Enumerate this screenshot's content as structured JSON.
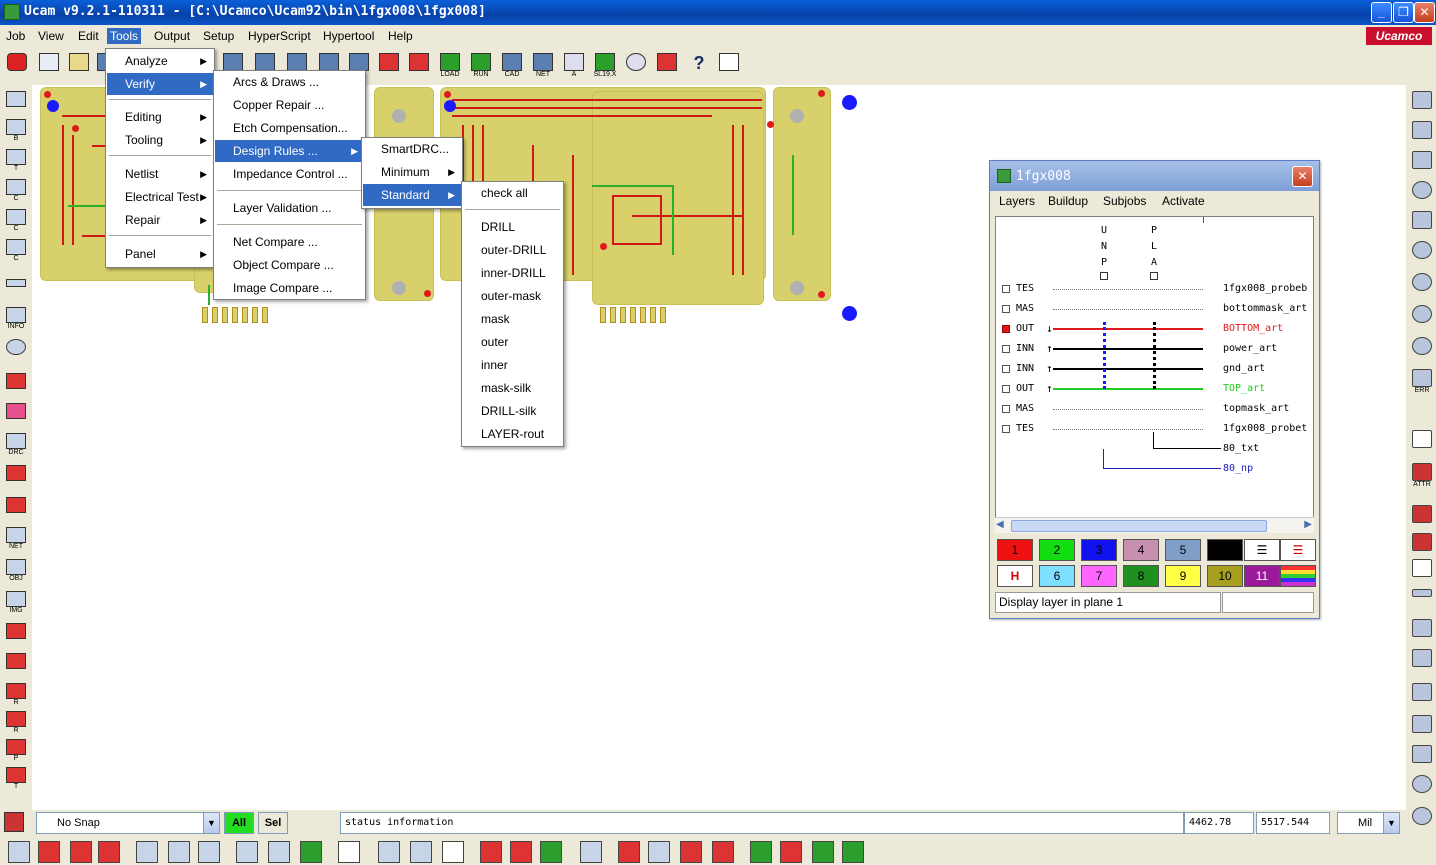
{
  "window": {
    "title": "Ucam v9.2.1-110311 - [C:\\Ucamco\\Ucam92\\bin\\1fgx008\\1fgx008]",
    "min_btn": "_",
    "max_btn": "❐",
    "close_btn": "✕"
  },
  "brand": {
    "logo_text": "Ucamco",
    "color": "#c8102e"
  },
  "menubar": [
    "Job",
    "View",
    "Edit",
    "Tools",
    "Output",
    "Setup",
    "HyperScript",
    "Hypertool",
    "Help"
  ],
  "menubar_active": "Tools",
  "toolbar": {
    "captions": [
      "LOAD",
      "RUN",
      "CAD",
      "NET",
      "A",
      "SL19.X",
      "",
      "",
      "?",
      ""
    ]
  },
  "lefttools": {
    "captions": [
      "",
      "B",
      "T",
      "C",
      "C",
      "C",
      "C",
      "",
      "INFO",
      "",
      "",
      "",
      "DRC",
      "",
      "",
      "NET",
      "OBJ",
      "IMG",
      "",
      "",
      "R",
      "R",
      "P",
      "P",
      "T",
      "T",
      ""
    ]
  },
  "righttools": {
    "captions": [
      "",
      "",
      "",
      "",
      "",
      "",
      "",
      "",
      "",
      "",
      "ERR",
      "",
      "",
      "ATTR",
      "",
      "",
      "",
      "",
      "",
      "",
      "",
      "",
      "",
      "",
      "",
      ""
    ]
  },
  "menus": {
    "tools": [
      "Analyze",
      "Verify",
      "Editing",
      "Tooling",
      "Netlist",
      "Electrical Test",
      "Repair",
      "Panel"
    ],
    "verify": [
      "Arcs & Draws ...",
      "Copper Repair ...",
      "Etch Compensation...",
      "Design Rules ...",
      "Impedance Control ...",
      "Layer Validation ...",
      "Net Compare ...",
      "Object Compare ...",
      "Image Compare ..."
    ],
    "design_rules": [
      "SmartDRC...",
      "Minimum",
      "Standard"
    ],
    "standard": [
      "check all",
      "DRILL",
      "outer-DRILL",
      "inner-DRILL",
      "outer-mask",
      "mask",
      "outer",
      "inner",
      "mask-silk",
      "DRILL-silk",
      "LAYER-rout"
    ]
  },
  "layer_window": {
    "title": "1fgx008",
    "close": "✕",
    "menu": [
      "Layers",
      "Buildup",
      "Subjobs",
      "Activate"
    ],
    "col_unp": [
      "U",
      "N",
      "P"
    ],
    "col_pla": [
      "P",
      "L",
      "A"
    ],
    "layers": [
      {
        "type": "TES",
        "arrow": "",
        "name": "1fgx008_probeb",
        "active": false,
        "color": "#000000"
      },
      {
        "type": "MAS",
        "arrow": "",
        "name": "bottommask_art",
        "active": false,
        "color": "#000000"
      },
      {
        "type": "OUT",
        "arrow": "↓",
        "name": "BOTTOM_art",
        "active": true,
        "color": "#e01a1a"
      },
      {
        "type": "INN",
        "arrow": "↑",
        "name": "power_art",
        "active": false,
        "color": "#000000"
      },
      {
        "type": "INN",
        "arrow": "↑",
        "name": "gnd_art",
        "active": false,
        "color": "#000000"
      },
      {
        "type": "OUT",
        "arrow": "↑",
        "name": "TOP_art",
        "active": false,
        "color": "#22cc22"
      },
      {
        "type": "MAS",
        "arrow": "",
        "name": "topmask_art",
        "active": false,
        "color": "#000000"
      },
      {
        "type": "TES",
        "arrow": "",
        "name": "1fgx008_probet",
        "active": false,
        "color": "#000000"
      },
      {
        "type": "",
        "arrow": "",
        "name": "80_txt",
        "active": false,
        "color": "#000000"
      },
      {
        "type": "",
        "arrow": "",
        "name": "80_np",
        "active": false,
        "color": "#2020c0"
      }
    ],
    "palette": [
      {
        "label": "1",
        "color": "#ee1111"
      },
      {
        "label": "2",
        "color": "#11dd11"
      },
      {
        "label": "3",
        "color": "#1111ee"
      },
      {
        "label": "4",
        "color": "#c890b0"
      },
      {
        "label": "5",
        "color": "#7f9fc8"
      },
      {
        "label": "",
        "color": "#000000"
      },
      {
        "label": "",
        "color": "#ffffff"
      },
      {
        "label": "",
        "color": "#ffffff"
      },
      {
        "label": "H",
        "color": "#ffffff"
      },
      {
        "label": "6",
        "color": "#7fdfff"
      },
      {
        "label": "7",
        "color": "#ff66ff"
      },
      {
        "label": "8",
        "color": "#1f8f1f"
      },
      {
        "label": "9",
        "color": "#ffff44"
      },
      {
        "label": "10",
        "color": "#a8a020"
      },
      {
        "label": "11",
        "color": "#9a1a9a"
      },
      {
        "label": "",
        "color": "#ffffff"
      }
    ],
    "status": "Display layer in plane 1"
  },
  "statusbar": {
    "snap": "No Snap",
    "all": "All",
    "sel": "Sel",
    "info": "status information",
    "x": "4462.78",
    "y": "5517.544",
    "unit": "Mil"
  }
}
